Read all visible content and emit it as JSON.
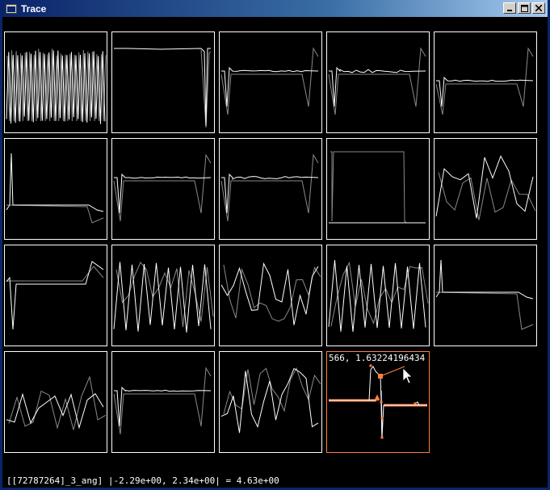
{
  "window": {
    "title": "Trace",
    "icon": "window-app-icon",
    "buttons": [
      "minimize",
      "maximize",
      "close"
    ],
    "title_color": "#0a246a"
  },
  "colors": {
    "primary_trace": "#ffffff",
    "secondary_trace": "#8a8a8a",
    "highlight": "#ff7f40"
  },
  "grid": {
    "rows": 4,
    "cols": 5,
    "active_panel": 18,
    "active_readout": "566, 1.63224196434"
  },
  "status_text": "[[72787264]_3_ang] |-2.29e+00, 2.34e+00| = 4.63e+00",
  "panels": [
    {
      "kind": "dense"
    },
    {
      "kind": "flat-dip"
    },
    {
      "kind": "step-spike"
    },
    {
      "kind": "step-ripple"
    },
    {
      "kind": "step-wide"
    },
    {
      "kind": "pulse-low"
    },
    {
      "kind": "step-spike"
    },
    {
      "kind": "step-ripple"
    },
    {
      "kind": "box"
    },
    {
      "kind": "zigzag-sparse"
    },
    {
      "kind": "step-mid"
    },
    {
      "kind": "zigzag"
    },
    {
      "kind": "zigzag-alt"
    },
    {
      "kind": "zigzag"
    },
    {
      "kind": "pulse-high"
    },
    {
      "kind": "zigzag-sparse"
    },
    {
      "kind": "step-spike"
    },
    {
      "kind": "zigzag-alt"
    },
    {
      "kind": "active"
    },
    {
      "kind": "empty"
    }
  ]
}
